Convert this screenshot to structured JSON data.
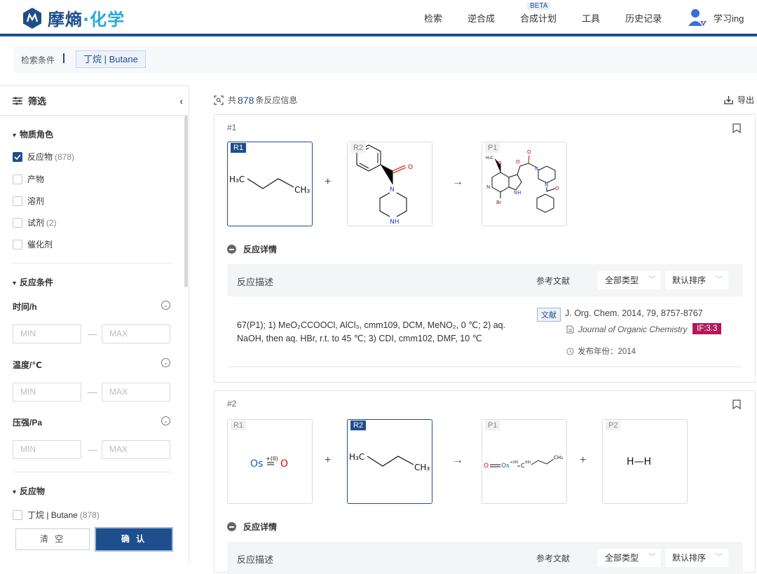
{
  "brand": {
    "name_main": "摩熵",
    "name_dot": "·",
    "name_accent": "化学"
  },
  "nav": {
    "items": [
      {
        "label": "检索"
      },
      {
        "label": "逆合成"
      },
      {
        "label": "合成计划",
        "badge": "BETA"
      },
      {
        "label": "工具"
      },
      {
        "label": "历史记录"
      }
    ]
  },
  "user": {
    "name": "学习ing"
  },
  "condition": {
    "label": "检索条件",
    "tag": "丁烷 | Butane"
  },
  "sidebar": {
    "title": "筛选",
    "role_section": "物质角色",
    "roles": [
      {
        "label": "反应物",
        "count": "(878)",
        "checked": true
      },
      {
        "label": "产物",
        "count": "",
        "checked": false
      },
      {
        "label": "溶剂",
        "count": "",
        "checked": false
      },
      {
        "label": "试剂",
        "count": "(2)",
        "checked": false
      },
      {
        "label": "催化剂",
        "count": "",
        "checked": false
      }
    ],
    "cond_section": "反应条件",
    "time_label": "时间/h",
    "temp_label": "温度/℃",
    "pressure_label": "压强/Pa",
    "min_placeholder": "MIN",
    "max_placeholder": "MAX",
    "reactant_section": "反应物",
    "reactant_item": {
      "label": "丁烷 | Butane",
      "count": "(878)"
    },
    "clear_label": "清 空",
    "confirm_label": "确 认"
  },
  "results": {
    "prefix": "共",
    "count": "878",
    "suffix": "条反应信息",
    "export_label": "导出"
  },
  "cards": [
    {
      "index": "#1",
      "molecules": [
        {
          "tag": "R1"
        },
        {
          "tag": "R2"
        },
        {
          "tag": "P1"
        }
      ],
      "detail_label": "反应详情",
      "table": {
        "desc_header": "反应描述",
        "ref_header": "参考文献",
        "type_select": "全部类型",
        "sort_select": "默认排序"
      },
      "description": "67(P1); 1) MeO₂CCOOCl, AlCl₃, cmm109, DCM, MeNO₂, 0 ℃; 2) aq. NaOH, then aq. HBr, r.t. to 45 ℃; 3) CDI, cmm102, DMF, 10 ℃",
      "ref": {
        "badge": "文献",
        "title": "J. Org. Chem. 2014, 79, 8757-8767",
        "journal": "Journal of Organic Chemistry",
        "impact": "IF:3.3",
        "year_label": "发布年份：2014"
      }
    },
    {
      "index": "#2",
      "molecules": [
        {
          "tag": "R1"
        },
        {
          "tag": "R2"
        },
        {
          "tag": "P1"
        },
        {
          "tag": "P2"
        }
      ],
      "detail_label": "反应详情",
      "table": {
        "desc_header": "反应描述",
        "ref_header": "参考文献",
        "type_select": "全部类型",
        "sort_select": "默认排序"
      }
    }
  ],
  "chem": {
    "h3c": "H₃C",
    "ch3": "CH₃",
    "os_label": "Os",
    "os_charge": "+(II)",
    "o_label": "O",
    "hh": "H—H",
    "n_label": "N",
    "nh_label": "NH",
    "h_label": "H",
    "o_small": "O",
    "br_label": "Br",
    "p1b_o": "O",
    "p1b_os": "Os",
    "p1b_os_charge": "+(III)",
    "p1b_c": "C",
    "p1b_c_charge": "(III)",
    "p1b_ch3": "CH₃"
  },
  "colors": {
    "primary": "#1f4e8c",
    "accent": "#2aa7d9",
    "if_badge": "#b0195b"
  }
}
